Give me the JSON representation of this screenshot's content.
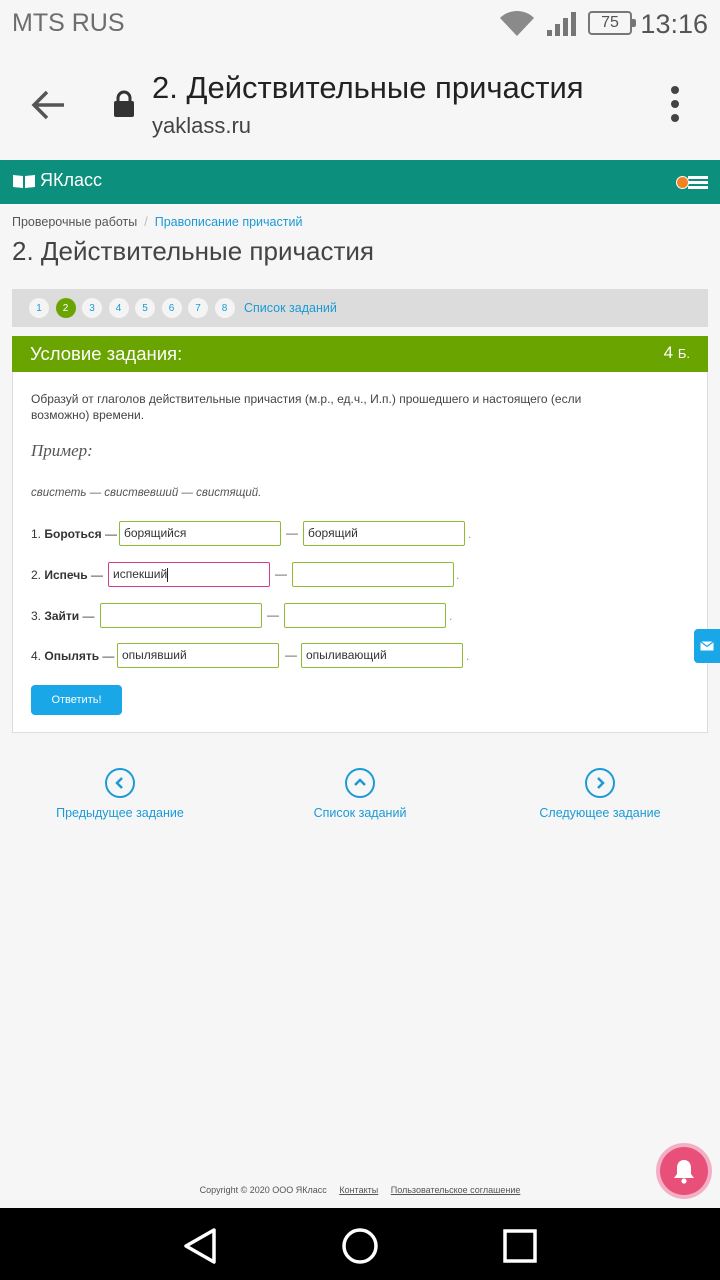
{
  "status_bar": {
    "carrier": "MTS RUS",
    "battery": "75",
    "time": "13:16"
  },
  "browser": {
    "title": "2. Действительные причастия",
    "url": "yaklass.ru"
  },
  "site": {
    "logo": "ЯКласс"
  },
  "breadcrumb": {
    "item1": "Проверочные работы",
    "separator": "/",
    "item2": "Правописание причастий"
  },
  "page_title": "2. Действительные причастия",
  "pager": {
    "pages": [
      "1",
      "2",
      "3",
      "4",
      "5",
      "6",
      "7",
      "8"
    ],
    "active": "2",
    "list_link": "Список заданий"
  },
  "task": {
    "header": "Условие задания:",
    "points_value": "4",
    "points_unit": "Б.",
    "text": "Образуй от глаголов действительные причастия (м.р., ед.ч., И.п.) прошедшего и настоящего (если возможно) времени.",
    "example_title": "Пример:",
    "example": "свистеть — свиствевший — свистящий.",
    "rows": [
      {
        "num": "1.",
        "verb": "Бороться",
        "dash": "—",
        "past": "борящийся",
        "present": "борящий",
        "end": "."
      },
      {
        "num": "2.",
        "verb": "Испечь",
        "dash": "—",
        "past": "испекший",
        "present": "",
        "end": "."
      },
      {
        "num": "3.",
        "verb": "Зайти",
        "dash": "—",
        "past": "",
        "present": "",
        "end": "."
      },
      {
        "num": "4.",
        "verb": "Опылять",
        "dash": "—",
        "past": "опылявший",
        "present": "опыливающий",
        "end": "."
      }
    ],
    "answer_button": "Ответить!"
  },
  "nav": {
    "prev": "Предыдущее задание",
    "list": "Список заданий",
    "next": "Следующее задание"
  },
  "footer": {
    "copyright": "Copyright © 2020 ООО ЯКласс",
    "contacts": "Контакты",
    "agreement": "Пользовательское соглашение"
  },
  "colors": {
    "header_teal": "#0c8f7c",
    "green": "#6aa400",
    "blue": "#1aa7e8",
    "focus_border": "#cc3d8f"
  }
}
